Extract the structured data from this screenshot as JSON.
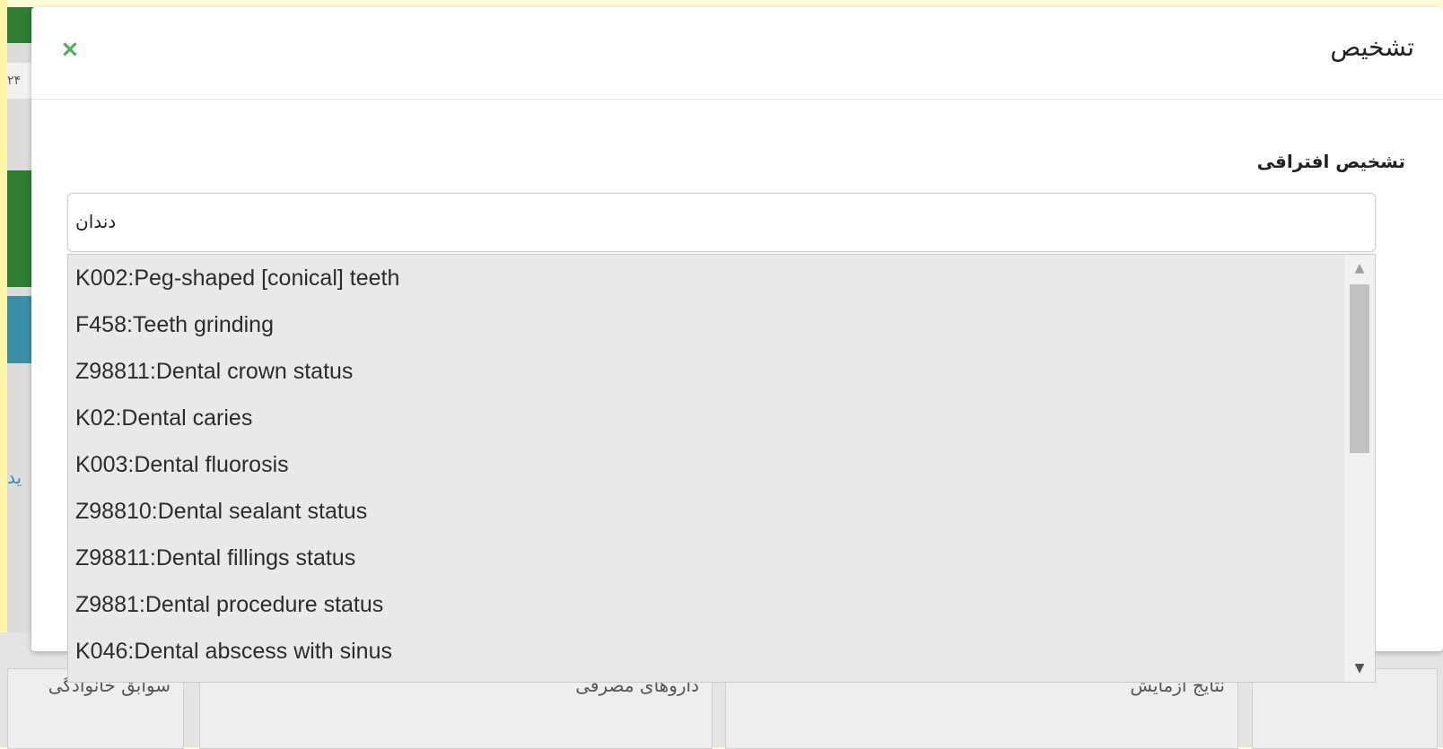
{
  "background": {
    "number_fragment": "۲۴",
    "link_fragment": "ید",
    "columns": [
      {
        "label": "سوابق خانوادگی"
      },
      {
        "label": "داروهای مصرفی"
      },
      {
        "label": "نتایج آزمایش"
      }
    ]
  },
  "modal": {
    "title": "تشخیص",
    "close_symbol": "×",
    "field_label": "تشخیص افتراقی",
    "search_value": "دندان"
  },
  "dropdown": {
    "items": [
      {
        "label": "K002:Peg-shaped [conical] teeth"
      },
      {
        "label": "F458:Teeth grinding"
      },
      {
        "label": "Z98811:Dental crown status"
      },
      {
        "label": "K02:Dental caries"
      },
      {
        "label": "K003:Dental fluorosis"
      },
      {
        "label": "Z98810:Dental sealant status"
      },
      {
        "label": "Z98811:Dental fillings status"
      },
      {
        "label": "Z9881:Dental procedure status"
      },
      {
        "label": "K046:Dental abscess with sinus"
      }
    ]
  },
  "colors": {
    "accent_green": "#4caf50",
    "header_green": "#2e7d32",
    "teal": "#3a8ea6",
    "page_background": "#fdfbd8"
  }
}
